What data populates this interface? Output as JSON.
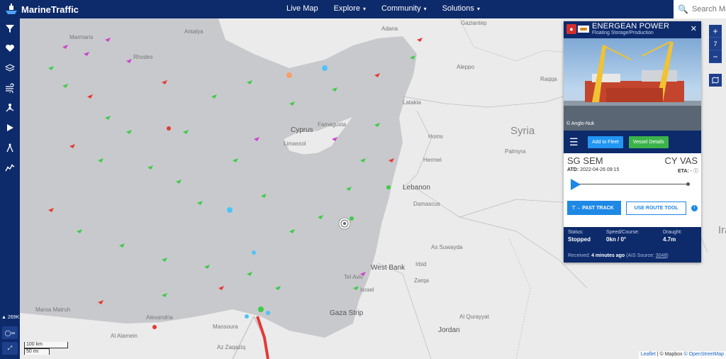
{
  "header": {
    "brand": "MarineTraffic",
    "nav": [
      {
        "label": "Live Map",
        "dropdown": false
      },
      {
        "label": "Explore",
        "dropdown": true
      },
      {
        "label": "Community",
        "dropdown": true
      },
      {
        "label": "Solutions",
        "dropdown": true
      }
    ],
    "search_placeholder": "Search MarineTraffic"
  },
  "sidebar": {
    "icons": [
      "filter-icon",
      "heart-icon",
      "layers-icon",
      "wind-icon",
      "vessel-route-icon",
      "play-icon",
      "compass-icon",
      "chart-icon"
    ],
    "vessel_count": "269K"
  },
  "map": {
    "places": [
      {
        "label": "Antalya"
      },
      {
        "label": "Adana"
      },
      {
        "label": "Gaziantep"
      },
      {
        "label": "Aleppo"
      },
      {
        "label": "Raqqa"
      },
      {
        "label": "Latakia"
      },
      {
        "label": "Syria"
      },
      {
        "label": "Palmyra"
      },
      {
        "label": "Cyprus"
      },
      {
        "label": "Limassol"
      },
      {
        "label": "Famagusta"
      },
      {
        "label": "Lebanon"
      },
      {
        "label": "Damascus"
      },
      {
        "label": "Homs"
      },
      {
        "label": "Hermel"
      },
      {
        "label": "As Suwayda"
      },
      {
        "label": "West Bank"
      },
      {
        "label": "Tel Aviv"
      },
      {
        "label": "Israel"
      },
      {
        "label": "Gaza Strip"
      },
      {
        "label": "Jordan"
      },
      {
        "label": "Alexandria"
      },
      {
        "label": "Marsa Matruh"
      },
      {
        "label": "Al Alamein"
      },
      {
        "label": "Mansoura"
      },
      {
        "label": "Az Zaqaziq"
      },
      {
        "label": "Zarqa"
      },
      {
        "label": "Irbid"
      },
      {
        "label": "Al Qurayyat"
      },
      {
        "label": "Marmaris"
      },
      {
        "label": "Rhodes"
      },
      {
        "label": "Iraq"
      }
    ],
    "scale": {
      "km": "100 km",
      "mi": "50 mi"
    },
    "attribution": {
      "leaflet": "Leaflet",
      "mapbox": "© Mapbox",
      "osm": "© OpenStreetMap"
    },
    "zoom_level": "7"
  },
  "vessel": {
    "name": "ENERGEAN POWER",
    "type": "Floating Storage/Production",
    "photo_credit": "© Anglo-Nuk",
    "buttons": {
      "fleet": "Add to Fleet",
      "details": "Vessel Details"
    },
    "origin": "SG SEM",
    "destination": "CY VAS",
    "atd_label": "ATD:",
    "atd_value": "2022-04-26 09:15",
    "eta_label": "ETA:",
    "eta_value": "-",
    "past_track": "PAST TRACK",
    "use_route_tool": "USE ROUTE TOOL",
    "status_label": "Status:",
    "status_value": "Stopped",
    "speed_label": "Speed/Course:",
    "speed_value": "0kn / 0°",
    "draught_label": "Draught:",
    "draught_value": "4.7m",
    "received_label": "Received:",
    "received_value": "4 minutes ago",
    "ais_source_label": "(AIS Source:",
    "ais_source_value": "3048",
    "ais_close": ")"
  }
}
